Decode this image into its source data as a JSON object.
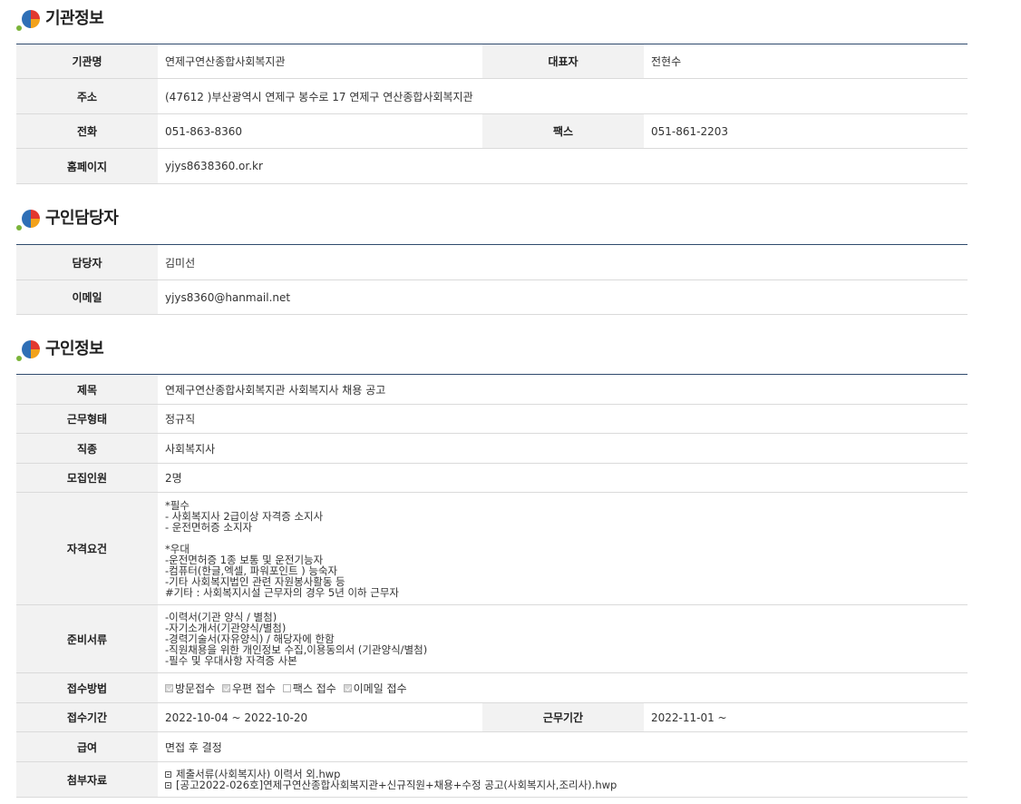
{
  "sections": {
    "org": {
      "title": "기관정보",
      "name_label": "기관명",
      "name": "연제구연산종합사회복지관",
      "rep_label": "대표자",
      "rep": "전현수",
      "addr_label": "주소",
      "addr": "(47612 )부산광역시 연제구 봉수로 17 연제구 연산종합사회복지관",
      "tel_label": "전화",
      "tel": "051-863-8360",
      "fax_label": "팩스",
      "fax": "051-861-2203",
      "home_label": "홈페이지",
      "home": "yjys8638360.or.kr"
    },
    "contact": {
      "title": "구인담당자",
      "person_label": "담당자",
      "person": "김미선",
      "email_label": "이메일",
      "email": "yjys8360@hanmail.net"
    },
    "job": {
      "title": "구인정보",
      "subject_label": "제목",
      "subject": "연제구연산종합사회복지관 사회복지사 채용 공고",
      "type_label": "근무형태",
      "type": "정규직",
      "kind_label": "직종",
      "kind": "사회복지사",
      "count_label": "모집인원",
      "count": "2명",
      "qual_label": "자격요건",
      "qual": "*필수\n - 사회복지사 2급이상 자격증 소지사\n- 운전면허증 소지자\n\n*우대\n-운전면허증 1종 보통 및 운전기능자\n-컴퓨터(한글,엑셀, 파워포인트 ) 능숙자\n-기타 사회복지법인 관련 자원봉사활동 등\n #기타 : 사회복지시설 근무자의 경우 5년 이하 근무자",
      "docs_label": "준비서류",
      "docs": "-이력서(기관 양식 / 별첨)\n-자기소개서(기관양식/별첨)\n-경력기술서(자유양식) / 해당자에 한함\n-직원채용을 위한 개인정보 수집,이용동의서 (기관양식/별첨)\n-필수 및 우대사항 자격증 사본",
      "method_label": "접수방법",
      "methods": [
        {
          "label": "방문접수",
          "checked": true
        },
        {
          "label": "우편 접수",
          "checked": true
        },
        {
          "label": "팩스 접수",
          "checked": false
        },
        {
          "label": "이메일 접수",
          "checked": true
        }
      ],
      "period_label": "접수기간",
      "period": "2022-10-04 ~ 2022-10-20",
      "work_label": "근무기간",
      "work": "2022-11-01 ~",
      "pay_label": "급여",
      "pay": "면접 후 결정",
      "files_label": "첨부자료",
      "files": [
        "제출서류(사회복지사) 이력서 외.hwp",
        "[공고2022-026호]연제구연산종합사회복지관+신규직원+채용+수정 공고(사회복지사,조리사).hwp"
      ]
    }
  }
}
